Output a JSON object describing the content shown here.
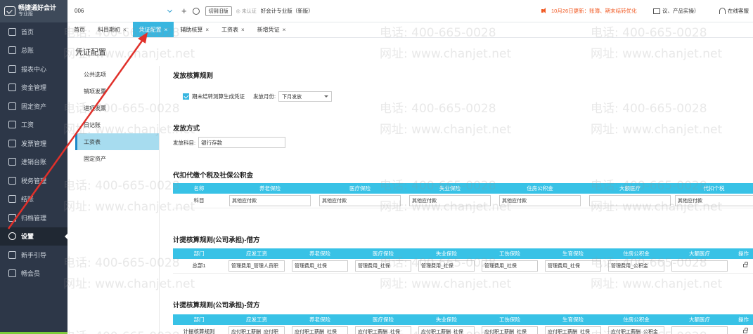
{
  "app": {
    "logo_name": "畅捷通好会计",
    "logo_sub": "专业版",
    "company": "006",
    "switch_label": "切到旧版",
    "verify_label": "未认证",
    "edition": "好会计专业版（新版）",
    "notice": "10月26日更新：账簿、期末结转优化",
    "feedback": "议、产品实操）",
    "service": "在线客服"
  },
  "sidebar": {
    "items": [
      {
        "label": "首页",
        "icon": "home-icon"
      },
      {
        "label": "总账",
        "icon": "ledger-icon"
      },
      {
        "label": "报表中心",
        "icon": "report-icon"
      },
      {
        "label": "资金管理",
        "icon": "wallet-icon"
      },
      {
        "label": "固定资产",
        "icon": "asset-icon"
      },
      {
        "label": "工资",
        "icon": "salary-icon"
      },
      {
        "label": "发票管理",
        "icon": "invoice-icon"
      },
      {
        "label": "进销台账",
        "icon": "inventory-icon"
      },
      {
        "label": "税务管理",
        "icon": "tax-icon"
      },
      {
        "label": "结账",
        "icon": "close-period-icon"
      },
      {
        "label": "归档管理",
        "icon": "archive-icon"
      },
      {
        "label": "设置",
        "icon": "gear-icon",
        "active": true
      },
      {
        "label": "新手引导",
        "icon": "guide-icon"
      },
      {
        "label": "畅会员",
        "icon": "member-icon"
      }
    ]
  },
  "tabs": [
    {
      "label": "首页",
      "closable": false
    },
    {
      "label": "科目期初",
      "closable": true
    },
    {
      "label": "凭证配置",
      "closable": true,
      "active": true
    },
    {
      "label": "辅助核算",
      "closable": true
    },
    {
      "label": "工资表",
      "closable": true
    },
    {
      "label": "新增凭证",
      "closable": true
    }
  ],
  "page": {
    "title": "凭证配置",
    "submenu": [
      "公共选项",
      "销项发票",
      "进项发票",
      "日记账",
      "工资表",
      "固定资产"
    ],
    "submenu_active": "工资表"
  },
  "payout_rule": {
    "title": "发放核算规则",
    "checkbox_label": "期末结转测算生成凭证",
    "checked": true,
    "month_label": "发放月份:",
    "month_value": "下月发放"
  },
  "payout_method": {
    "title": "发放方式",
    "subject_label": "发放科目:",
    "subject_value": "银行存款"
  },
  "withholding": {
    "title": "代扣代缴个税及社保公积金",
    "headers": [
      "名称",
      "养老保险",
      "医疗保险",
      "失业保险",
      "住房公积金",
      "大额医疗",
      "代扣个税"
    ],
    "row_label": "科目",
    "values": [
      "其他应付款",
      "其他应付款",
      "其他应付款",
      "其他应付款",
      "",
      "其他应付款"
    ]
  },
  "accrual_debit": {
    "title": "计提核算规则(公司承担)-借方",
    "headers": [
      "部门",
      "应发工资",
      "养老保险",
      "医疗保险",
      "失业保险",
      "工伤保险",
      "生育保险",
      "住房公积金",
      "大额医疗",
      "操作"
    ],
    "row_label": "总部1",
    "values": [
      "管理费用_管理人员职",
      "管理费用_社保",
      "管理费用_社保",
      "管理费用_社保",
      "管理费用_社保",
      "管理费用_社保",
      "管理费用_公积金",
      ""
    ]
  },
  "accrual_credit": {
    "title": "计提核算规则(公司承担)-贷方",
    "headers": [
      "部门",
      "应发工资",
      "养老保险",
      "医疗保险",
      "失业保险",
      "工伤保险",
      "生育保险",
      "住房公积金",
      "大额医疗",
      "操作"
    ],
    "row_label": "计提核算规则",
    "values": [
      "应付职工薪酬_应付职",
      "应付职工薪酬_社保",
      "应付职工薪酬_社保",
      "应付职工薪酬_社保",
      "应付职工薪酬_社保",
      "应付职工薪酬_社保",
      "应付职工薪酬_公积金",
      ""
    ]
  },
  "watermark": {
    "phone": "电话: 400-665-0028",
    "site": "网址: www.chanjet.net"
  },
  "colors": {
    "accent": "#38b6e0",
    "sidebar": "#2d3748",
    "notice": "#f15a24",
    "arrow": "#e0302a"
  }
}
